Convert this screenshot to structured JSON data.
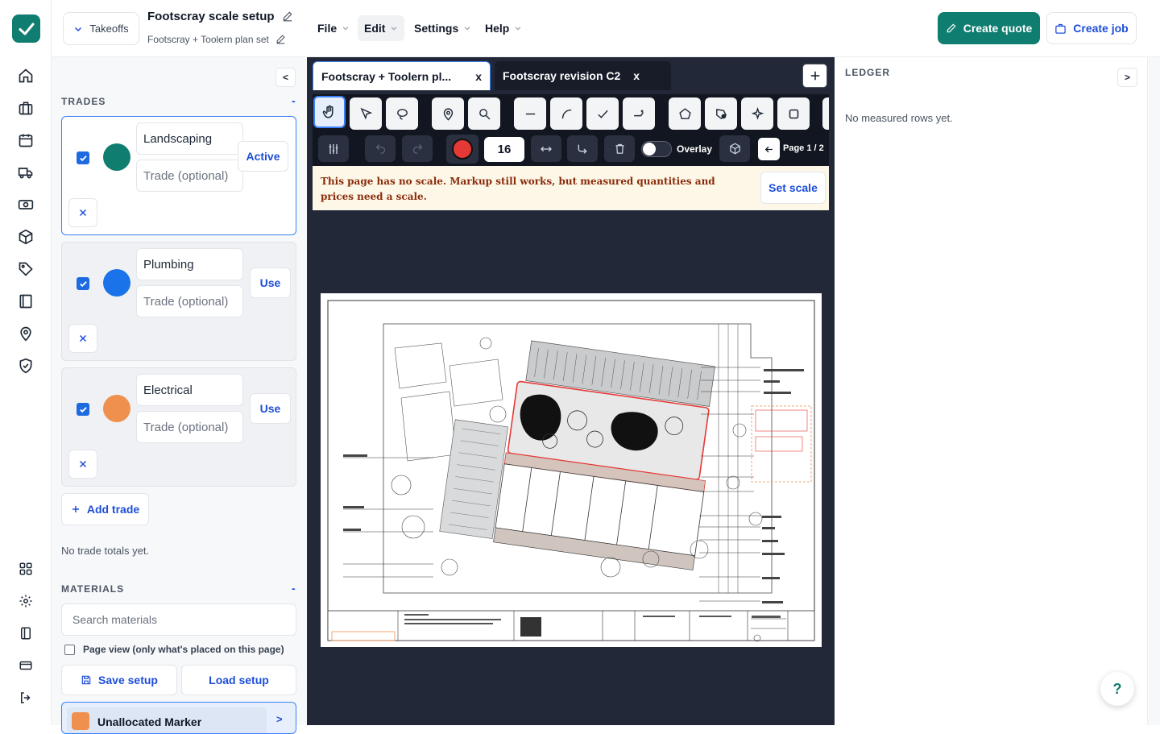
{
  "rail": {
    "icons": [
      "home-icon",
      "briefcase-icon",
      "calendar-icon",
      "truck-icon",
      "cash-icon",
      "box-icon",
      "tag-icon",
      "book-icon",
      "location-pin-icon",
      "shield-check-icon"
    ],
    "bottom_icons": [
      "grid-icon",
      "gear-icon",
      "sidebar-icon",
      "card-icon",
      "logout-icon"
    ]
  },
  "header": {
    "takeoffs_label": "Takeoffs",
    "title": "Footscray scale setup",
    "subtitle": "Footscray + Toolern plan set",
    "menus": [
      "File",
      "Edit",
      "Settings",
      "Help"
    ],
    "create_quote": "Create quote",
    "create_job": "Create job"
  },
  "left": {
    "collapse_label": "<",
    "trades_heading": "TRADES",
    "collapse_dash": "-",
    "trades": [
      {
        "name": "Landscaping",
        "placeholder": "Trade (optional)",
        "action": "Active",
        "color": "#0f7d6f",
        "checked": true
      },
      {
        "name": "Plumbing",
        "placeholder": "Trade (optional)",
        "action": "Use",
        "color": "#1a73e8",
        "checked": true
      },
      {
        "name": "Electrical",
        "placeholder": "Trade (optional)",
        "action": "Use",
        "color": "#f0904e",
        "checked": true
      }
    ],
    "add_trade": "Add trade",
    "no_totals": "No trade totals yet.",
    "materials_heading": "MATERIALS",
    "materials_dash": "-",
    "search_placeholder": "Search materials",
    "page_view_label": "Page view (only what's placed on this page)",
    "save_setup": "Save setup",
    "load_setup": "Load setup",
    "unallocated_label": "Unallocated Marker",
    "unallocated_chevron": ">"
  },
  "viewer": {
    "tabs": [
      {
        "label": "Footscray + Toolern pl...",
        "close": "x"
      },
      {
        "label": "Footscray revision C2",
        "close": "x"
      }
    ],
    "stroke_value": "16",
    "overlay_label": "Overlay",
    "page_label": "Page 1 / 2",
    "warning": "This page has no scale. Markup still works, but measured quantities and prices need a scale.",
    "set_scale": "Set scale",
    "markup_color": "#e53935"
  },
  "ledger": {
    "heading": "LEDGER",
    "expand_label": ">",
    "empty": "No measured rows yet."
  },
  "help_label": "?"
}
